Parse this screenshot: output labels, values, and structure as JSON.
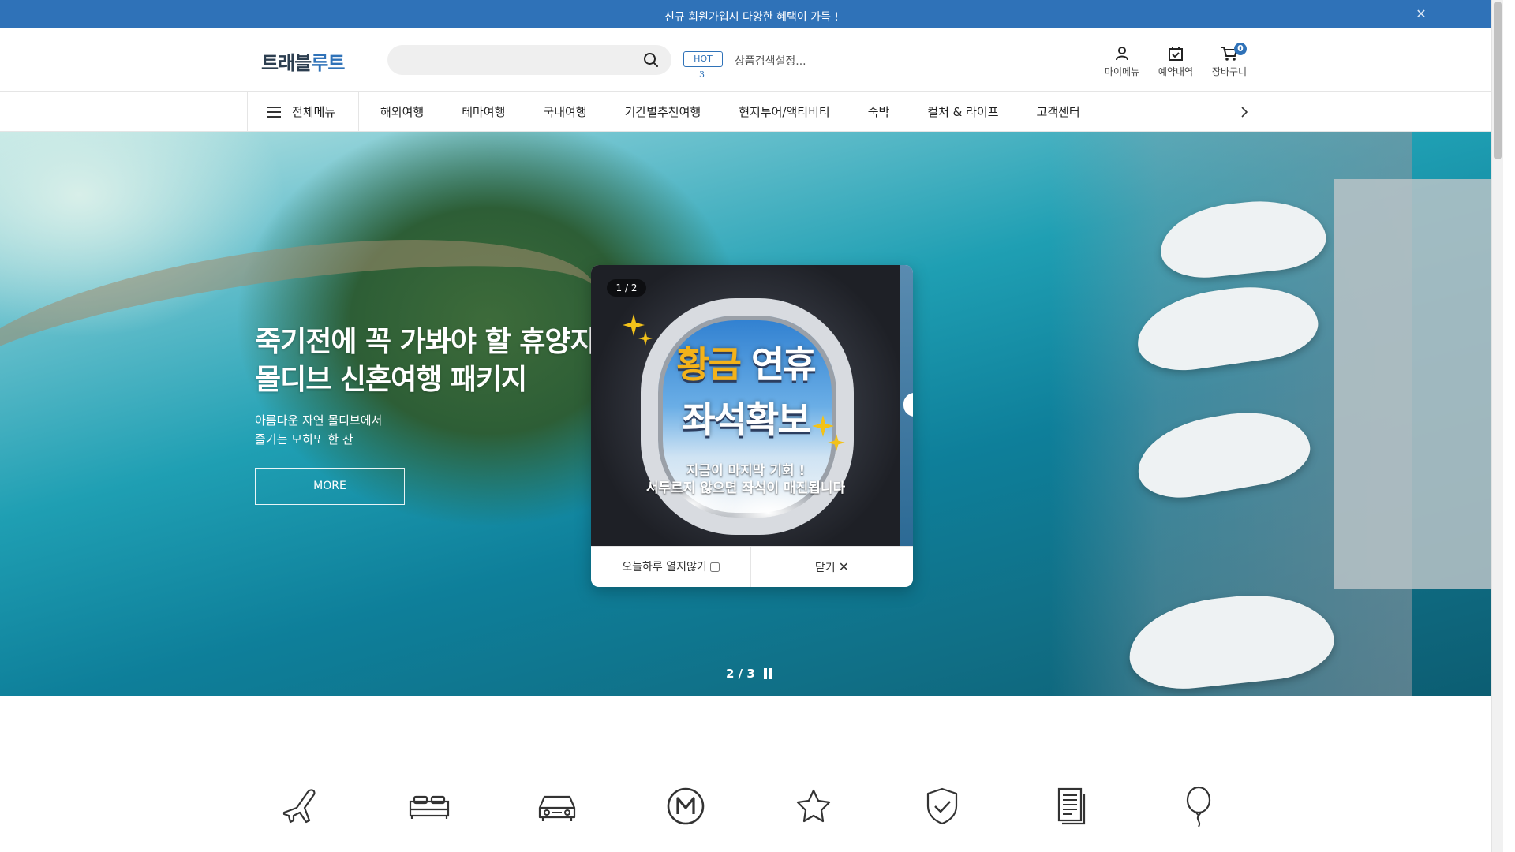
{
  "top_banner": {
    "text": "신규 회원가입시 다양한 혜택이 가득 !",
    "close_icon": "close-icon"
  },
  "header": {
    "logo": {
      "part1": "트래블",
      "part2": "루트"
    },
    "search": {
      "value": "",
      "placeholder": ""
    },
    "hot_label": "HOT",
    "hot_rank": "3",
    "trending_keyword": "상품검색설정...",
    "utilities": [
      {
        "label": "마이메뉴",
        "icon": "person-icon"
      },
      {
        "label": "예약내역",
        "icon": "calendar-check-icon"
      },
      {
        "label": "장바구니",
        "icon": "cart-icon",
        "badge": "0"
      }
    ]
  },
  "nav": {
    "all_menu": "전체메뉴",
    "items": [
      "해외여행",
      "테마여행",
      "국내여행",
      "기간별추천여행",
      "현지투어/액티비티",
      "숙박",
      "컬처 & 라이프",
      "고객센터"
    ]
  },
  "hero": {
    "title": "죽기전에 꼭 가봐야 할 휴양지\n몰디브 신혼여행 패키지",
    "subtitle": "아름다운 자연 몰디브에서\n즐기는 모히또 한 잔",
    "more_label": "MORE",
    "slide_counter": "2 / 3"
  },
  "popup": {
    "counter": "1 / 2",
    "headline_gold": "황금",
    "headline_white": " 연휴",
    "headline2": "좌석확보",
    "body": "지금이 마지막 기회 !\n서두르지 않으면 좌석이 매진됩니다",
    "dont_show_today": "오늘하루 열지않기",
    "close_label": "닫기"
  },
  "categories": [
    {
      "icon": "airplane-icon"
    },
    {
      "icon": "bed-icon"
    },
    {
      "icon": "car-icon"
    },
    {
      "icon": "m-coin-icon"
    },
    {
      "icon": "star-icon"
    },
    {
      "icon": "shield-check-icon"
    },
    {
      "icon": "document-icon"
    },
    {
      "icon": "balloon-icon"
    }
  ],
  "colors": {
    "brand_blue": "#2f72b8"
  }
}
